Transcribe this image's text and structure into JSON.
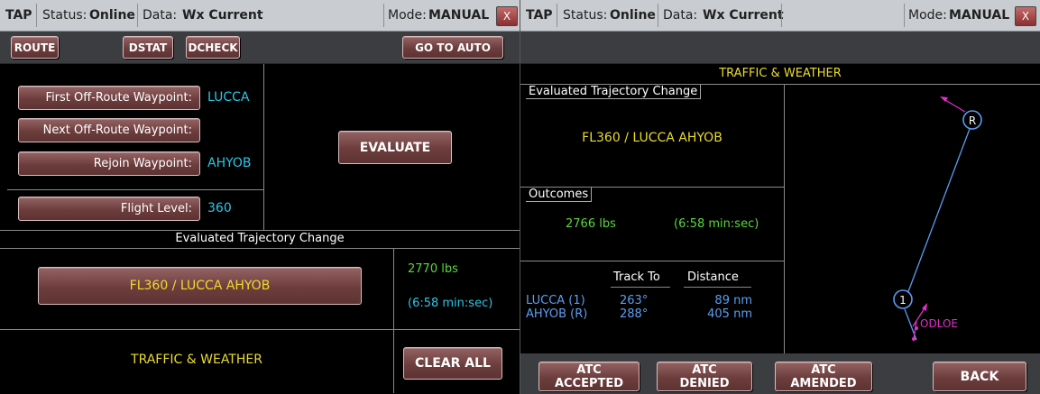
{
  "left": {
    "topbar": {
      "app": "TAP",
      "status_label": "Status:",
      "status_value": "Online",
      "data_label": "Data:",
      "data_value": "Wx Current",
      "mode_label": "Mode:",
      "mode_value": "MANUAL",
      "close": "X"
    },
    "toolbar": {
      "route": "ROUTE",
      "dstat": "DSTAT",
      "dcheck": "DCHECK",
      "go_auto": "GO TO AUTO"
    },
    "first_off_route_label": "First Off-Route Waypoint:",
    "first_off_route_value": "LUCCA",
    "next_off_route_label": "Next Off-Route Waypoint:",
    "next_off_route_value": "",
    "rejoin_label": "Rejoin Waypoint:",
    "rejoin_value": "AHYOB",
    "flight_level_label": "Flight Level:",
    "flight_level_value": "360",
    "evaluate": "EVALUATE",
    "evaluated_header": "Evaluated Trajectory Change",
    "trajectory": "FL360 / LUCCA  AHYOB",
    "fuel": "2770 lbs",
    "time": "(6:58 min:sec)",
    "traffic_weather": "TRAFFIC & WEATHER",
    "clear_all": "CLEAR ALL"
  },
  "right": {
    "topbar": {
      "app": "TAP",
      "status_label": "Status:",
      "status_value": "Online",
      "data_label": "Data:",
      "data_value": "Wx Current",
      "mode_label": "Mode:",
      "mode_value": "MANUAL",
      "close": "X"
    },
    "title": "TRAFFIC & WEATHER",
    "evaluated_label": "Evaluated Trajectory Change",
    "trajectory": "FL360 / LUCCA  AHYOB",
    "outcomes_label": "Outcomes",
    "fuel": "2766 lbs",
    "time": "(6:58 min:sec)",
    "table": {
      "headers": [
        "Track To",
        "Distance"
      ],
      "rows": [
        {
          "name": "LUCCA  (1)",
          "track": "263°",
          "distance": "89 nm"
        },
        {
          "name": "AHYOB  (R)",
          "track": "288°",
          "distance": "405 nm"
        }
      ]
    },
    "map": {
      "marker_r": "R",
      "marker_1": "1",
      "waypoint": "ODLOE",
      "route_color": "#5a9cf0",
      "traffic_color": "#e030c8"
    },
    "buttons": {
      "accepted": [
        "ATC",
        "ACCEPTED"
      ],
      "denied": [
        "ATC",
        "DENIED"
      ],
      "amended": [
        "ATC",
        "AMENDED"
      ],
      "back": "BACK"
    }
  }
}
